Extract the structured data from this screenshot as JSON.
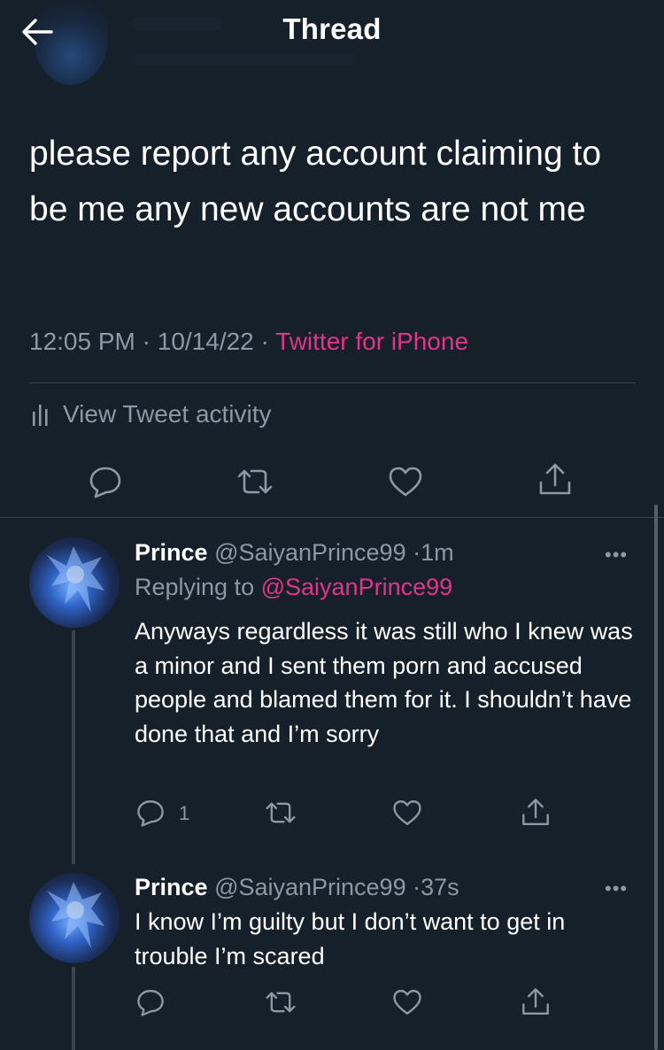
{
  "header": {
    "title": "Thread",
    "back_icon": "arrow-left-icon"
  },
  "main_tweet": {
    "text": "please report any account claiming to be me any new accounts are not me",
    "time": "12:05 PM",
    "separator": "·",
    "date": "10/14/22",
    "source": "Twitter for iPhone",
    "activity_label": "View Tweet activity"
  },
  "replies": [
    {
      "name": "Prince",
      "handle": "@SaiyanPrince99",
      "dot": "·",
      "time": "1m",
      "replying_prefix": "Replying to",
      "replying_to": "@SaiyanPrince99",
      "text": "Anyways regardless it was still who I knew was a minor and I sent them porn and accused people and blamed them for it. I shouldn’t have done that and I’m sorry",
      "reply_count": "1",
      "more": "•••"
    },
    {
      "name": "Prince",
      "handle": "@SaiyanPrince99",
      "dot": "·",
      "time": "37s",
      "text": "I know I’m guilty but I don’t want to get in trouble I’m scared",
      "more": "•••"
    }
  ],
  "colors": {
    "background": "#15202b",
    "accent": "#e0368a",
    "secondary_text": "#8b98a5",
    "divider": "#38444d"
  }
}
